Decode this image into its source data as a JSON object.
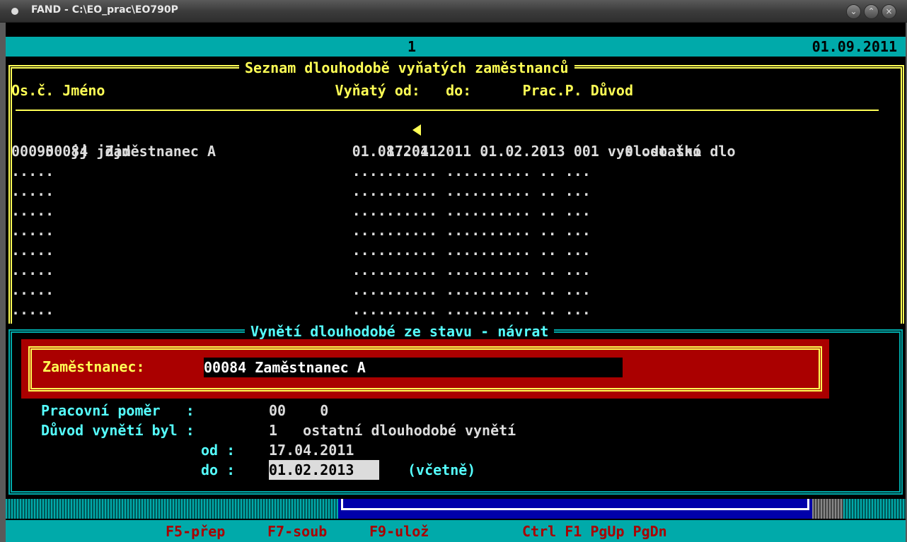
{
  "window": {
    "title": "FAND - C:\\EO_prac\\EO790P",
    "buttons": [
      "⌄",
      "⌃",
      "×"
    ]
  },
  "topbar": {
    "page": "1",
    "date": "01.09.2011"
  },
  "list": {
    "title": "Seznam dlouhodobě vyňatých zaměstnanců",
    "header": "Os.č. Jméno                           Vyňatý od:   do:      Prac.P. Důvod",
    "rows": [
      "00084  Zaměstnanec A                    17.04.2011 01.02.2013 00    0 ostatní dlo",
      "00095  jj jdjd                          01.08.2011  .  .      01    1 vysl.do ško",
      ".....                                   .......... .......... .. ...",
      ".....                                   .......... .......... .. ...",
      ".....                                   .......... .......... .. ...",
      ".....                                   .......... .......... .. ...",
      ".....                                   .......... .......... .. ...",
      ".....                                   .......... .......... .. ...",
      ".....                                   .......... .......... .. ...",
      ".....                                   .......... .......... .. ..."
    ]
  },
  "detail": {
    "title": "Vynětí dlouhodobé ze stavu - návrat",
    "employee_label": "Zaměstnanec:",
    "employee_value": "00084 Zaměstnanec A",
    "pracovni_pomer_label": "Pracovní poměr   :",
    "pracovni_pomer_value": "00    0",
    "duvod_label": "Důvod vynětí byl :",
    "duvod_value": "1   ostatní dlouhodobé vynětí",
    "od_label": "od :",
    "od_value": "17.04.2011",
    "do_label": "do :",
    "do_value": "01.02.2013",
    "do_note": "(včetně)"
  },
  "fkeys": {
    "f5": "F5-přep",
    "f7": "F7-soub",
    "f9": "F9-ulož",
    "ctrl": "Ctrl F1 PgUp PgDn"
  }
}
